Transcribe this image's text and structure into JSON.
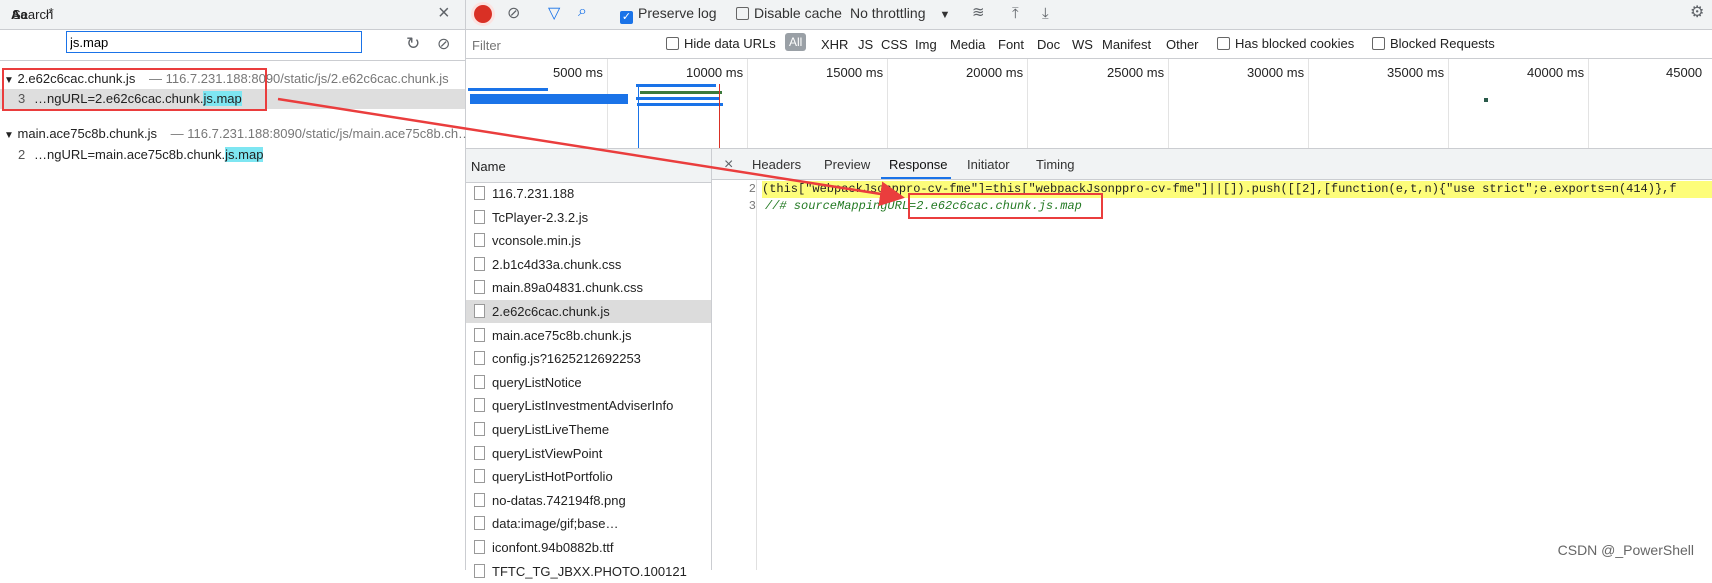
{
  "search": {
    "title": "Search",
    "case_label": "Aa",
    "regex_label": ".*",
    "query": "js.map",
    "results": [
      {
        "file": "2.e62c6cac.chunk.js",
        "url": "116.7.231.188:8090/static/js/2.e62c6cac.chunk.js",
        "line_no": "3",
        "match_prefix": "…ngURL=2.e62c6cac.chunk.",
        "match_hl": "js.map"
      },
      {
        "file": "main.ace75c8b.chunk.js",
        "url": "116.7.231.188:8090/static/js/main.ace75c8b.ch…",
        "line_no": "2",
        "match_prefix": "…ngURL=main.ace75c8b.chunk.",
        "match_hl": "js.map"
      }
    ]
  },
  "toolbar": {
    "preserve_log": "Preserve log",
    "disable_cache": "Disable cache",
    "throttling": "No throttling"
  },
  "filterbar": {
    "placeholder": "Filter",
    "hide_data_urls": "Hide data URLs",
    "types": [
      "All",
      "XHR",
      "JS",
      "CSS",
      "Img",
      "Media",
      "Font",
      "Doc",
      "WS",
      "Manifest",
      "Other"
    ],
    "has_blocked_cookies": "Has blocked cookies",
    "blocked_requests": "Blocked Requests"
  },
  "timeline": {
    "ticks": [
      "5000 ms",
      "10000 ms",
      "15000 ms",
      "20000 ms",
      "25000 ms",
      "30000 ms",
      "35000 ms",
      "40000 ms",
      "45000"
    ]
  },
  "requests": {
    "header": "Name",
    "items": [
      "116.7.231.188",
      "TcPlayer-2.3.2.js",
      "vconsole.min.js",
      "2.b1c4d33a.chunk.css",
      "main.89a04831.chunk.css",
      "2.e62c6cac.chunk.js",
      "main.ace75c8b.chunk.js",
      "config.js?1625212692253",
      "queryListNotice",
      "queryListInvestmentAdviserInfo",
      "queryListLiveTheme",
      "queryListViewPoint",
      "queryListHotPortfolio",
      "no-datas.742194f8.png",
      "data:image/gif;base…",
      "iconfont.94b0882b.ttf",
      "TFTC_TG_JBXX.PHOTO.100121"
    ],
    "selected": "2.e62c6cac.chunk.js"
  },
  "detail": {
    "tabs": [
      "Headers",
      "Preview",
      "Response",
      "Initiator",
      "Timing"
    ],
    "active_tab": "Response",
    "lines": [
      {
        "no": "2",
        "text": "(this[\"webpackJsonppro-cv-fme\"]=this[\"webpackJsonppro-cv-fme\"]||[]).push([[2],[function(e,t,n){\"use strict\";e.exports=n(414)},f"
      },
      {
        "no": "3",
        "text": "//# sourceMappingURL=2.e62c6cac.chunk.js.map"
      }
    ]
  },
  "watermark": "CSDN @_PowerShell",
  "colors": {
    "accent": "#1a73e8",
    "record": "#d93025",
    "annotation": "#ea3d3d",
    "highlight": "#7ee6f2"
  }
}
